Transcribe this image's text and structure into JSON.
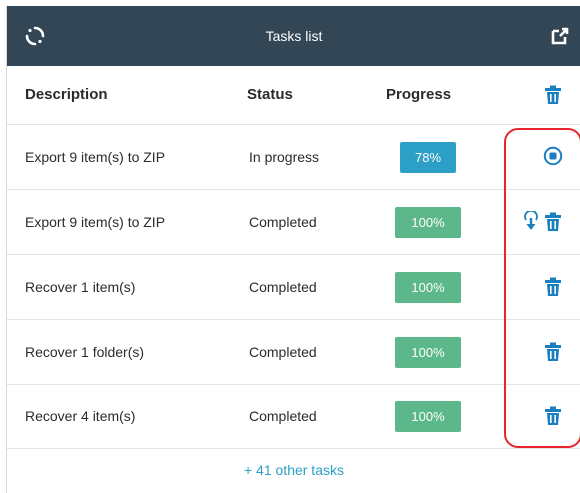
{
  "header": {
    "title": "Tasks list"
  },
  "columns": {
    "description": "Description",
    "status": "Status",
    "progress": "Progress"
  },
  "tasks": [
    {
      "description": "Export 9 item(s) to ZIP",
      "status": "In progress",
      "progress": "78%",
      "progress_value": 0.78,
      "actions": [
        "stop"
      ]
    },
    {
      "description": "Export 9 item(s) to ZIP",
      "status": "Completed",
      "progress": "100%",
      "progress_value": 1.0,
      "actions": [
        "download",
        "delete"
      ]
    },
    {
      "description": "Recover 1 item(s)",
      "status": "Completed",
      "progress": "100%",
      "progress_value": 1.0,
      "actions": [
        "delete"
      ]
    },
    {
      "description": "Recover 1 folder(s)",
      "status": "Completed",
      "progress": "100%",
      "progress_value": 1.0,
      "actions": [
        "delete"
      ]
    },
    {
      "description": "Recover 4 item(s)",
      "status": "Completed",
      "progress": "100%",
      "progress_value": 1.0,
      "actions": [
        "delete"
      ]
    }
  ],
  "footer": {
    "more_link": "+ 41 other tasks"
  },
  "colors": {
    "header_bg": "#324655",
    "accent_blue": "#2b9fc6",
    "success_green": "#5cb88a",
    "highlight_red": "#e8242c",
    "icon_blue": "#1a7fc1"
  },
  "icons": {
    "refresh": "refresh-icon",
    "popout": "external-link-icon",
    "delete": "trash-icon",
    "stop": "stop-circle-icon",
    "download": "download-icon"
  }
}
